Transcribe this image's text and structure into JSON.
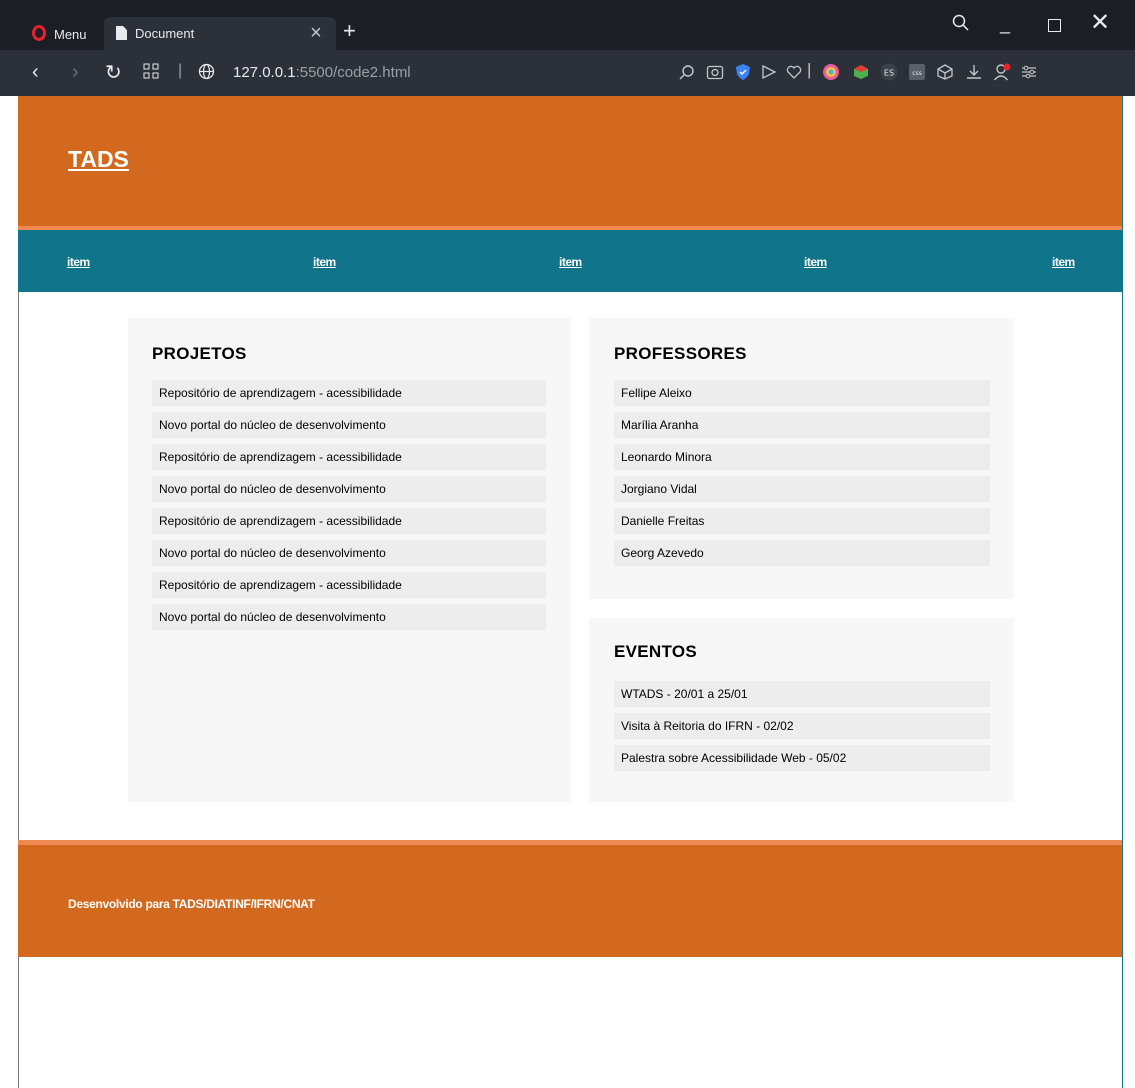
{
  "browser": {
    "menu_label": "Menu",
    "tab_title": "Document",
    "tab_close": "×",
    "new_tab": "+",
    "url_host": "127.0.0.1",
    "url_path": ":5500/code2.html"
  },
  "header": {
    "logo": "TADS"
  },
  "nav": {
    "items": [
      "item",
      "item",
      "item",
      "item",
      "item"
    ]
  },
  "projetos": {
    "title": "PROJETOS",
    "items": [
      "Repositório de aprendizagem - acessibilidade",
      "Novo portal do núcleo de desenvolvimento",
      "Repositório de aprendizagem - acessibilidade",
      "Novo portal do núcleo de desenvolvimento",
      "Repositório de aprendizagem - acessibilidade",
      "Novo portal do núcleo de desenvolvimento",
      "Repositório de aprendizagem - acessibilidade",
      "Novo portal do núcleo de desenvolvimento"
    ]
  },
  "professores": {
    "title": "PROFESSORES",
    "items": [
      "Fellipe Aleixo",
      "Marília Aranha",
      "Leonardo Minora",
      "Jorgiano Vidal",
      "Danielle Freitas",
      "Georg Azevedo"
    ]
  },
  "eventos": {
    "title": "EVENTOS",
    "items": [
      "WTADS - 20/01 a 25/01",
      "Visita à Reitoria do IFRN - 02/02",
      "Palestra sobre Acessibilidade Web - 05/02"
    ]
  },
  "footer": {
    "text": "Desenvolvido para TADS/DIATINF/IFRN/CNAT"
  },
  "colors": {
    "header": "#d2691e",
    "accent_line": "#f08a52",
    "nav": "#10758a",
    "card": "#f7f7f7",
    "row": "#ededed"
  }
}
